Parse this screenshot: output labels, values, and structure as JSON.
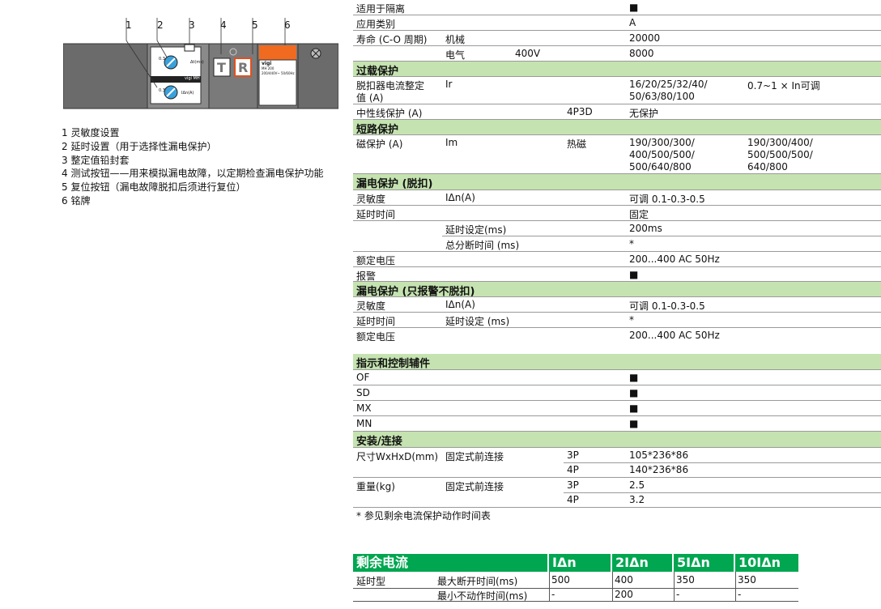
{
  "diagram": {
    "callouts": [
      "1",
      "2",
      "3",
      "4",
      "5",
      "6"
    ],
    "module_label": "vigi MH",
    "dial1_top": "0.3",
    "dial1_unit": "Δt(ms)",
    "dial2_unit": "IΔn(A)",
    "dial2_top": "0.3",
    "test_btn": "T",
    "reset_btn": "R",
    "plate_lines": [
      "vigi",
      "MH 200",
      "200/440V~ 50/60Hz"
    ]
  },
  "legend": [
    "1 灵敏度设置",
    "2 延时设置（用于选择性漏电保护）",
    "3 整定值铅封套",
    "4 测试按钮——用来模拟漏电故障，以定期检查漏电保护功能",
    "5 复位按钮（漏电故障脱扣后须进行复位）",
    "6 铭牌"
  ],
  "spec": {
    "r_isolation": {
      "label": "适用于隔离",
      "val": "■"
    },
    "r_category": {
      "label": "应用类别",
      "val": "A"
    },
    "r_life_mech": {
      "label": "寿命 (C-O 周期)",
      "sub": "机械",
      "val": "20000"
    },
    "r_life_elec": {
      "sub": "电气",
      "volt": "400V",
      "val": "8000"
    },
    "s_overload": "过载保护",
    "r_ir": {
      "label1": "脱扣器电流整定",
      "label2": "值 (A)",
      "sym": "Ir",
      "v1": "16/20/25/32/40/",
      "v2": "50/63/80/100",
      "note": "0.7~1 × In可调"
    },
    "r_neutral": {
      "label": "中性线保护 (A)",
      "pole": "4P3D",
      "val": "无保护"
    },
    "s_short": "短路保护",
    "r_im": {
      "label": "磁保护 (A)",
      "sym": "Im",
      "type": "热磁",
      "a1": "190/300/300/",
      "a2": "400/500/500/",
      "a3": "500/640/800",
      "b1": "190/300/400/",
      "b2": "500/500/500/",
      "b3": "640/800"
    },
    "s_earth": "漏电保护 (脱扣)",
    "r_sens": {
      "label": "灵敏度",
      "sym": "IΔn(A)",
      "val": "可调 0.1-0.3-0.5"
    },
    "r_delay": {
      "label": "延时时间",
      "val": "固定"
    },
    "r_delay_set": {
      "sub": "延时设定(ms)",
      "val": "200ms"
    },
    "r_total": {
      "sub": "总分断时间 (ms)",
      "val": "*"
    },
    "r_voltage": {
      "label": "额定电压",
      "val": "200...400 AC 50Hz"
    },
    "r_alarm": {
      "label": "报警",
      "val": "■"
    },
    "s_earth_alarm": "漏电保护 (只报警不脱扣)",
    "r_sens2": {
      "label": "灵敏度",
      "sym": "IΔn(A)",
      "val": "可调 0.1-0.3-0.5"
    },
    "r_delay2": {
      "label": "延时时间",
      "sub": "延时设定 (ms)",
      "val": "*"
    },
    "r_voltage2": {
      "label": "额定电压",
      "val": "200...400 AC 50Hz"
    },
    "s_aux": "指示和控制辅件",
    "r_of": {
      "label": "OF",
      "val": "■"
    },
    "r_sd": {
      "label": "SD",
      "val": "■"
    },
    "r_mx": {
      "label": "MX",
      "val": "■"
    },
    "r_mn": {
      "label": "MN",
      "val": "■"
    },
    "s_install": "安装/连接",
    "r_dim": {
      "label": "尺寸WxHxD(mm)",
      "sub": "固定式前连接",
      "p1": "3P",
      "v1": "105*236*86",
      "p2": "4P",
      "v2": "140*236*86"
    },
    "r_weight": {
      "label": "重量(kg)",
      "sub": "固定式前连接",
      "p1": "3P",
      "v1": "2.5",
      "p2": "4P",
      "v2": "3.2"
    }
  },
  "note": "* 参见剩余电流保护动作时间表",
  "residual": {
    "title": "剩余电流",
    "headers": [
      "IΔn",
      "2IΔn",
      "5IΔn",
      "10IΔn"
    ],
    "group": "延时型",
    "rows": [
      {
        "label": "最大断开时间(ms)",
        "vals": [
          "500",
          "400",
          "350",
          "350"
        ]
      },
      {
        "label": "最小不动作时间(ms)",
        "vals": [
          "-",
          "200",
          "-",
          "-"
        ]
      }
    ]
  }
}
